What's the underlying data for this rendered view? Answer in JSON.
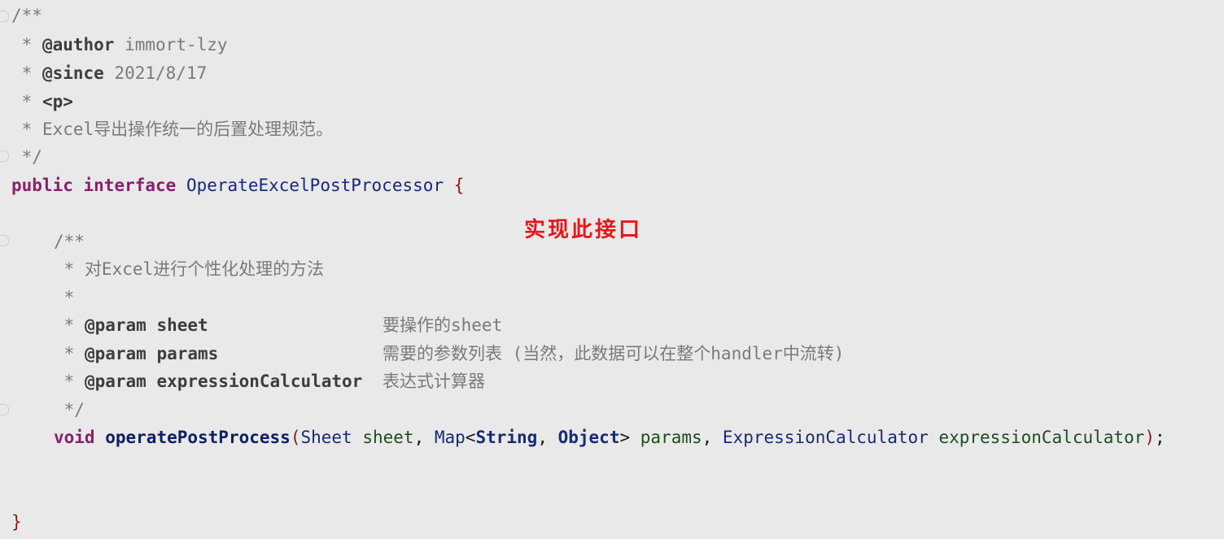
{
  "code": {
    "doc1": {
      "open": "/**",
      "author_tag": "@author",
      "author_value": "immort-lzy",
      "since_tag": "@since",
      "since_value": "2021/8/17",
      "p_tag": "<p>",
      "desc": "Excel导出操作统一的后置处理规范。",
      "close": "*/"
    },
    "decl": {
      "public": "public",
      "interface": "interface",
      "name": "OperateExcelPostProcessor",
      "brace_open": "{"
    },
    "doc2": {
      "open": "/**",
      "desc": "对Excel进行个性化处理的方法",
      "params": [
        {
          "tag": "@param",
          "name": "sheet",
          "desc": "要操作的sheet"
        },
        {
          "tag": "@param",
          "name": "params",
          "desc": "需要的参数列表 (当然，此数据可以在整个handler中流转)"
        },
        {
          "tag": "@param",
          "name": "expressionCalculator",
          "desc": "表达式计算器"
        }
      ],
      "close": "*/"
    },
    "method": {
      "ret": "void",
      "name": "operatePostProcess",
      "p1_type": "Sheet",
      "p1_name": "sheet",
      "p2_type": "Map",
      "p2_g1": "String",
      "p2_g2": "Object",
      "p2_name": "params",
      "p3_type": "ExpressionCalculator",
      "p3_name": "expressionCalculator"
    },
    "brace_close": "}"
  },
  "annotation": {
    "text": "实现此接口",
    "color": "#e8151b"
  }
}
